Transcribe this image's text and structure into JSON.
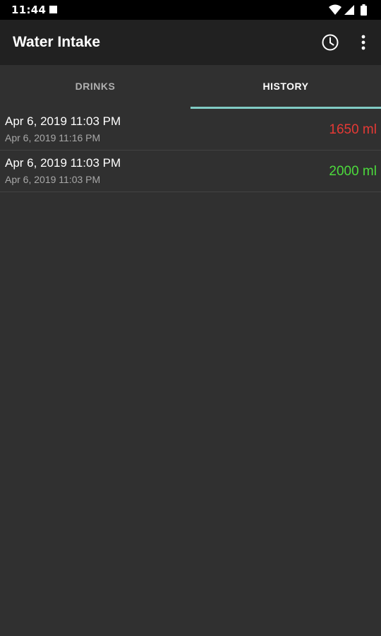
{
  "status_bar": {
    "time": "11:44"
  },
  "app_bar": {
    "title": "Water Intake"
  },
  "tabs": [
    {
      "label": "DRINKS",
      "active": false
    },
    {
      "label": "HISTORY",
      "active": true
    }
  ],
  "history": [
    {
      "primary": "Apr 6, 2019 11:03 PM",
      "secondary": "Apr 6, 2019 11:16 PM",
      "amount": "1650 ml",
      "amount_color": "#e53935"
    },
    {
      "primary": "Apr 6, 2019 11:03 PM",
      "secondary": "Apr 6, 2019 11:03 PM",
      "amount": "2000 ml",
      "amount_color": "#4cda3c"
    }
  ],
  "colors": {
    "background": "#303030",
    "app_bar": "#212121",
    "tab_indicator": "#80cbc4"
  },
  "icons": {
    "status": [
      "notification-square-icon",
      "wifi-icon",
      "cell-signal-icon",
      "battery-icon"
    ],
    "app_bar": [
      "history-clock-icon",
      "overflow-menu-icon"
    ]
  }
}
